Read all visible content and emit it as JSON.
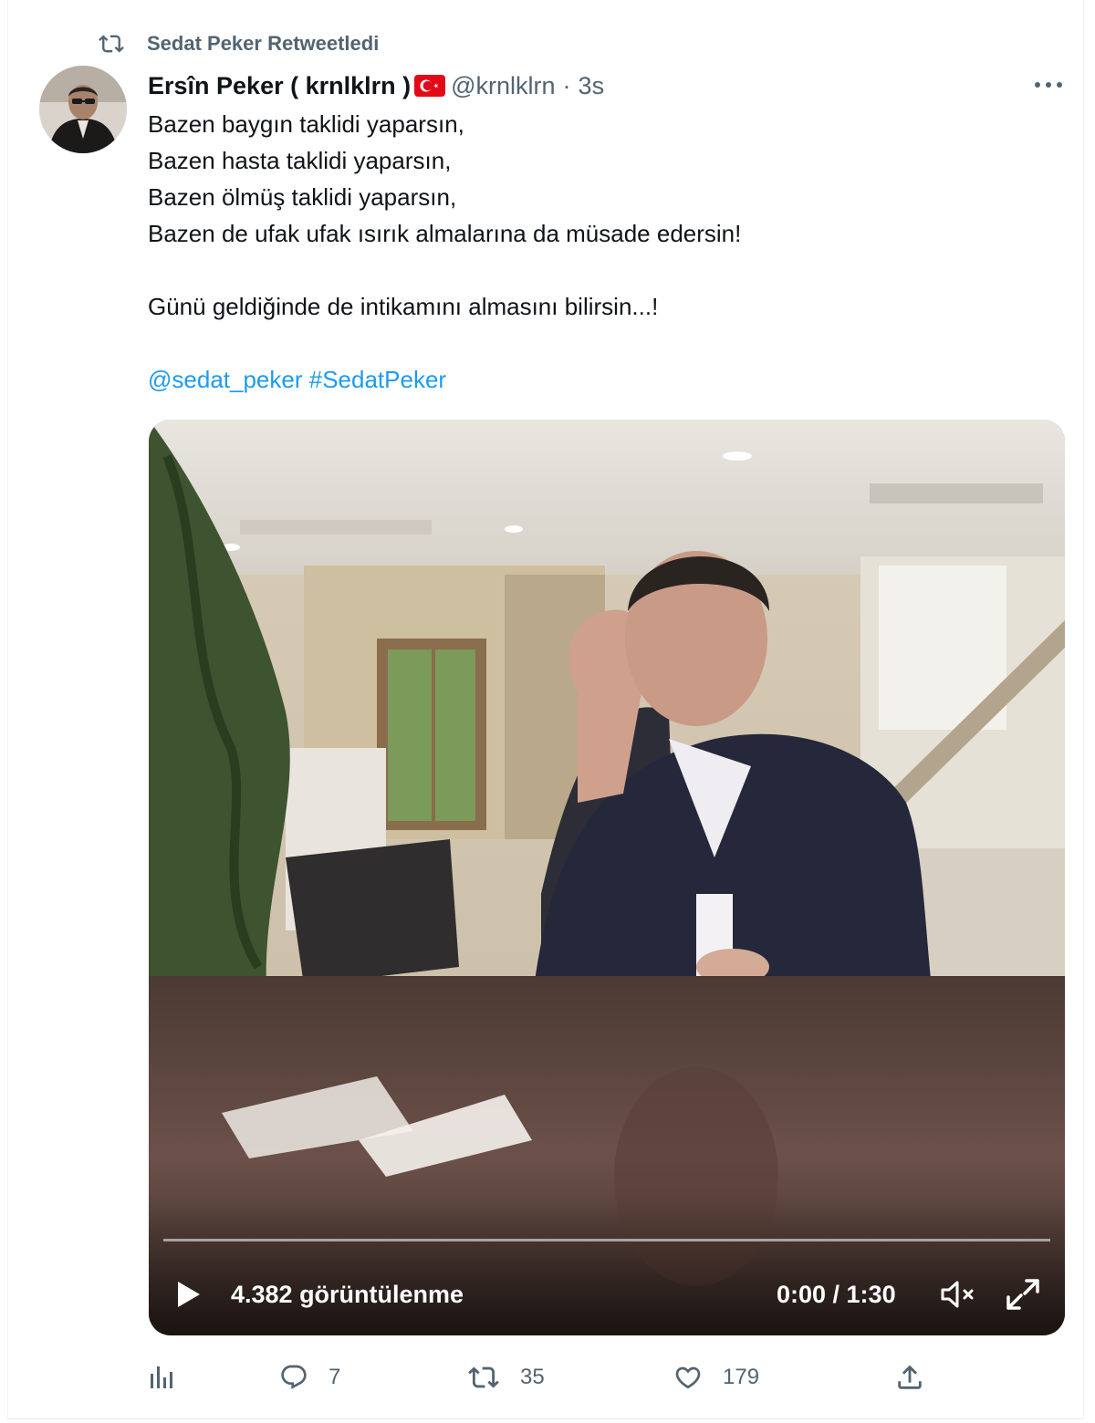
{
  "retweet_context": {
    "label": "Sedat Peker Retweetledi"
  },
  "tweet": {
    "author": {
      "display_name": "Ersîn Peker ( krnlklrn )",
      "handle": "@krnlklrn",
      "separator": "·",
      "time": "3s"
    },
    "text_lines": [
      "Bazen baygın taklidi yaparsın,",
      "Bazen hasta taklidi yaparsın,",
      "Bazen ölmüş taklidi yaparsın,",
      "Bazen de ufak ufak ısırık almalarına da müsade edersin!",
      "Günü geldiğinde de intikamını almasını bilirsin...!"
    ],
    "mention": "@sedat_peker",
    "hashtag": "#SedatPeker"
  },
  "video": {
    "views": "4.382 görüntülenme",
    "time": "0:00 / 1:30",
    "progress": 0
  },
  "actions": {
    "replies": "7",
    "retweets": "35",
    "likes": "179"
  },
  "icons": {
    "retweet": "retweet-icon",
    "more": "more-icon",
    "analytics": "analytics-icon",
    "reply": "reply-icon",
    "like": "heart-icon",
    "share": "share-icon",
    "play": "play-icon",
    "mute": "muted-speaker-icon",
    "fullscreen": "fullscreen-icon",
    "flag": "turkey-flag-icon"
  },
  "colors": {
    "link": "#1d9bf0",
    "secondary_text": "#536471",
    "primary_text": "#0f1419",
    "flag_red": "#e30a17"
  }
}
